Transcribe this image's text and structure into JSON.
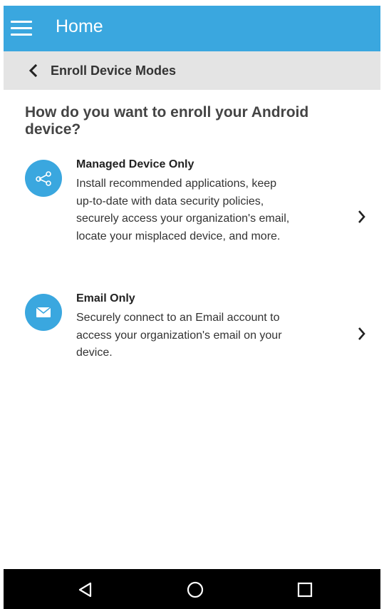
{
  "appbar": {
    "title": "Home",
    "menu_icon": "hamburger-menu-icon",
    "color": "#3aa7df"
  },
  "subheader": {
    "back_icon": "chevron-left-icon",
    "title": "Enroll Device Modes"
  },
  "question": "How do you want to enroll your Android device?",
  "options": [
    {
      "icon": "share-nodes-icon",
      "title": "Managed Device Only",
      "description": "Install recommended applications, keep up-to-date with data security policies, securely access your organization's email, locate your misplaced device, and more.",
      "chevron": "chevron-right-icon"
    },
    {
      "icon": "envelope-icon",
      "title": "Email Only",
      "description": "Securely connect to an Email account to access your organization's email on your device.",
      "chevron": "chevron-right-icon"
    }
  ],
  "navbar": {
    "back_icon": "nav-back-triangle-icon",
    "home_icon": "nav-home-circle-icon",
    "recent_icon": "nav-recent-square-icon"
  }
}
